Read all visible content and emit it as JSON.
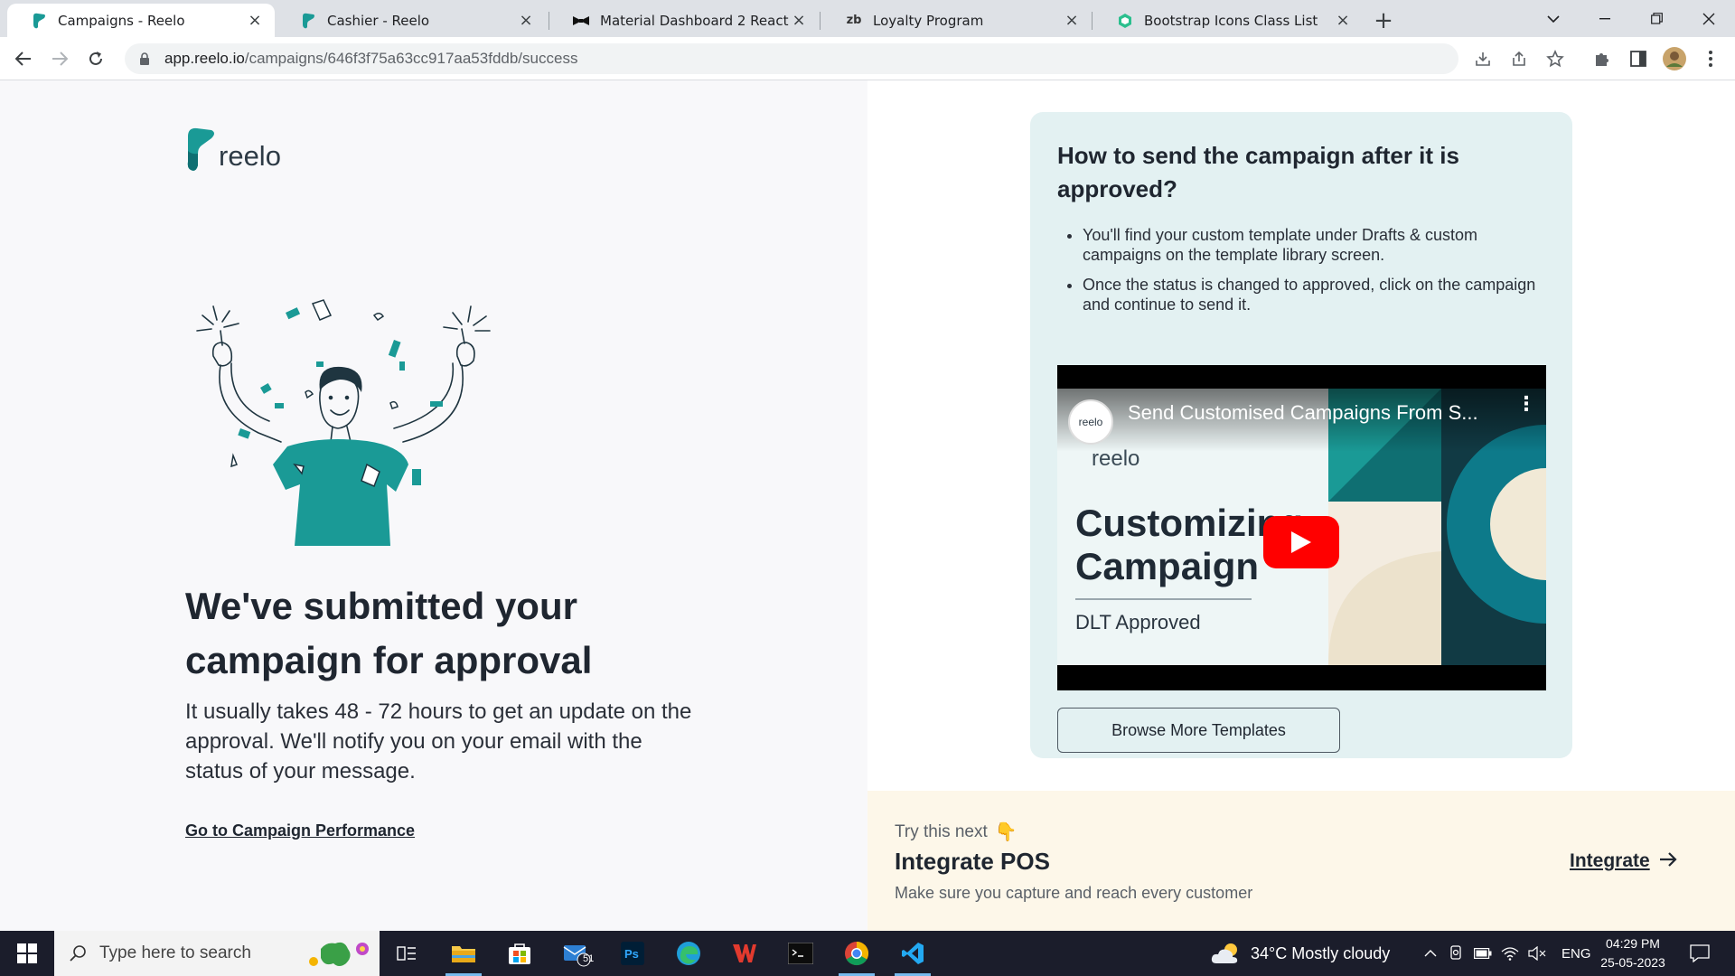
{
  "browser": {
    "tabs": [
      {
        "title": "Campaigns - Reelo",
        "active": true,
        "favicon": "reelo-favicon"
      },
      {
        "title": "Cashier - Reelo",
        "active": false,
        "favicon": "reelo-favicon"
      },
      {
        "title": "Material Dashboard 2 React",
        "active": false,
        "favicon": "bowtie-favicon"
      },
      {
        "title": "Loyalty Program",
        "active": false,
        "favicon": "zb-favicon"
      },
      {
        "title": "Bootstrap Icons Class List",
        "active": false,
        "favicon": "hexagon-favicon"
      }
    ],
    "url_host": "app.reelo.io",
    "url_path": "/campaigns/646f3f75a63cc917aa53fddb/success"
  },
  "page": {
    "logo_text": "reelo",
    "headline": "We've submitted your campaign for approval",
    "subtext": "It usually takes 48 - 72 hours to get an update on the approval. We'll notify you on your email with the status of your message.",
    "performance_link": "Go to Campaign Performance",
    "card": {
      "title": "How to send the campaign after it is approved?",
      "bullets": [
        "You'll find your custom template under Drafts & custom campaigns on the template library screen.",
        "Once the status is changed to approved, click on the campaign and continue to send it."
      ],
      "video": {
        "title": "Send Customised Campaigns From S...",
        "channel_text": "reelo",
        "brand_text": "reelo",
        "big_line1": "Customizing",
        "big_line2": "Campaign",
        "dlt_text": "DLT Approved"
      },
      "browse_button": "Browse More Templates"
    },
    "next": {
      "try_label": "Try this next",
      "title": "Integrate POS",
      "subtitle": "Make sure you capture and reach every customer",
      "link": "Integrate"
    }
  },
  "taskbar": {
    "search_placeholder": "Type here to search",
    "mail_badge": "51",
    "weather": "34°C  Mostly cloudy",
    "lang": "ENG",
    "time": "04:29 PM",
    "date": "25-05-2023"
  },
  "colors": {
    "accent_teal": "#1a9a96",
    "card_bg": "#e3f1f2",
    "next_bg": "#fdf7e9",
    "yt_red": "#ff0000"
  }
}
